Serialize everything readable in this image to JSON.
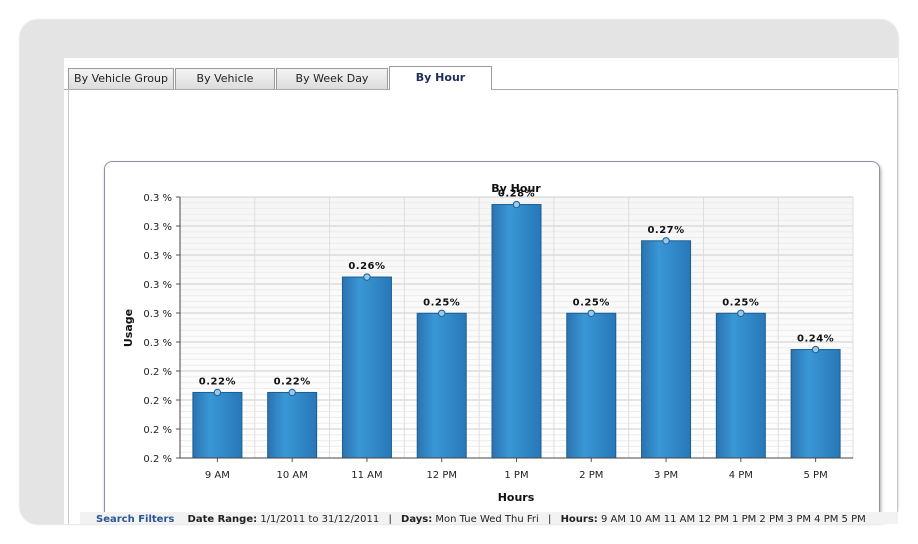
{
  "tabs": [
    {
      "label": "By Vehicle Group",
      "active": false
    },
    {
      "label": "By Vehicle",
      "active": false
    },
    {
      "label": "By Week Day",
      "active": false
    },
    {
      "label": "By Hour",
      "active": true
    }
  ],
  "chart_data": {
    "type": "bar",
    "title": "By Hour",
    "xlabel": "Hours",
    "ylabel": "Usage",
    "categories": [
      "9 AM",
      "10 AM",
      "11 AM",
      "12 PM",
      "1 PM",
      "2 PM",
      "3 PM",
      "4 PM",
      "5 PM"
    ],
    "values": [
      0.2226,
      0.2226,
      0.2624,
      0.2499,
      0.2874,
      0.2499,
      0.2749,
      0.2499,
      0.2374
    ],
    "data_labels": [
      "0.22%",
      "0.22%",
      "0.26%",
      "0.25%",
      "0.28%",
      "0.25%",
      "0.27%",
      "0.25%",
      "0.24%"
    ],
    "y_ticks": [
      0.2,
      0.21,
      0.22,
      0.23,
      0.24,
      0.25,
      0.26,
      0.27,
      0.28,
      0.29
    ],
    "y_tick_labels": [
      "0.2 %",
      "0.2 %",
      "0.2 %",
      "0.2 %",
      "0.3 %",
      "0.3 %",
      "0.3 %",
      "0.3 %",
      "0.3 %",
      "0.3 %"
    ],
    "ylim": [
      0.2,
      0.29
    ],
    "grid": true,
    "bar_color": "#2f86c8",
    "bar_edge_color": "#1b5f92"
  },
  "filters": {
    "title": "Search Filters",
    "date_range_label": "Date Range:",
    "date_range_value": "1/1/2011 to 31/12/2011",
    "days_label": "Days:",
    "days_value": "Mon Tue Wed Thu Fri",
    "hours_label": "Hours:",
    "hours_value": "9 AM 10 AM 11 AM 12 PM 1 PM 2 PM 3 PM 4 PM 5 PM",
    "separator": "|"
  }
}
